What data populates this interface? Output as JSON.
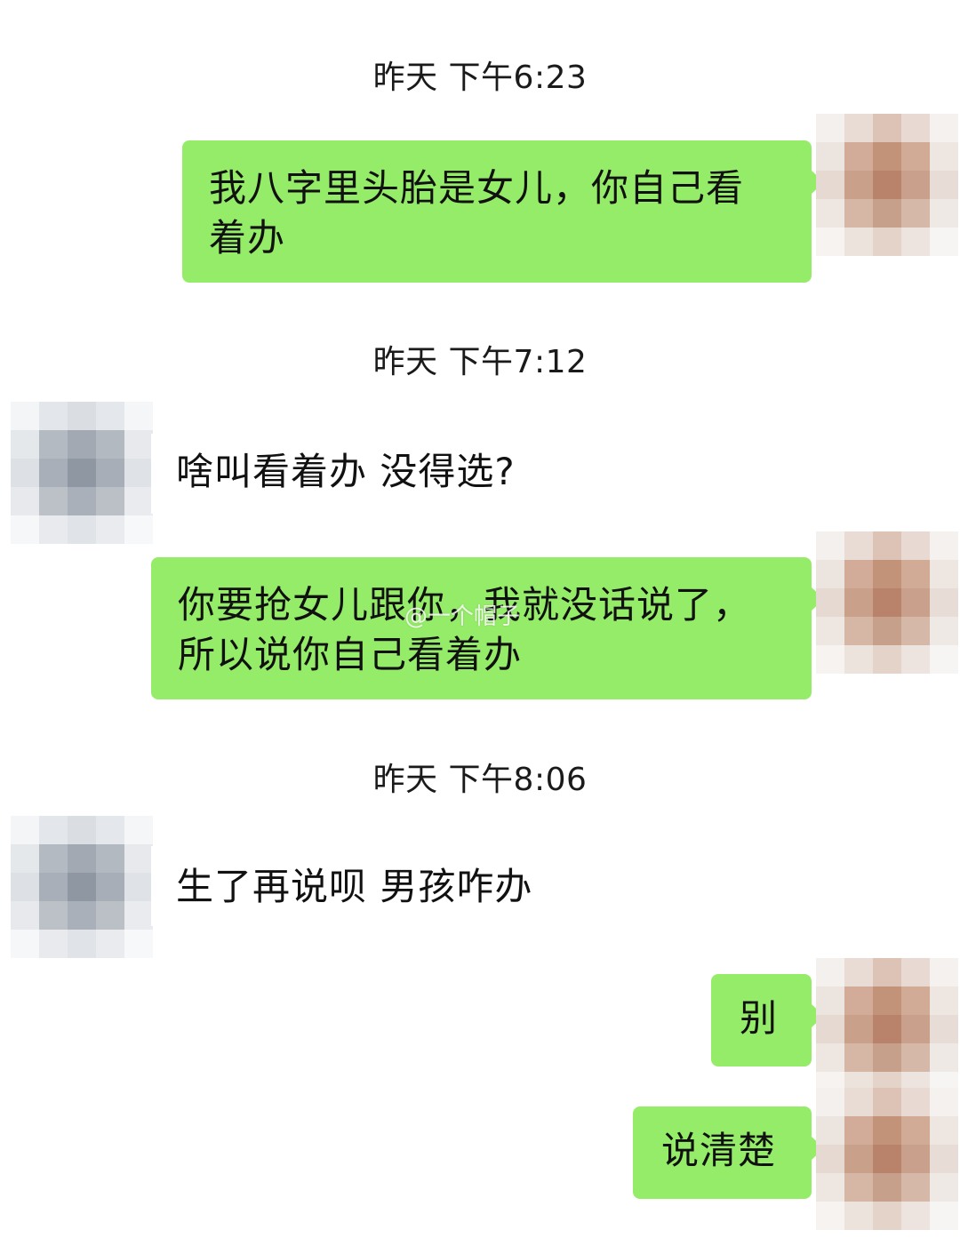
{
  "messages": [
    {
      "kind": "time",
      "text": "昨天 下午6:23"
    },
    {
      "kind": "self",
      "lines": [
        "我八字里头胎是女儿，你自己看",
        "着办"
      ]
    },
    {
      "kind": "time",
      "text": "昨天 下午7:12"
    },
    {
      "kind": "other",
      "text": "啥叫看着办  没得选?"
    },
    {
      "kind": "self",
      "lines": [
        "你要抢女儿跟你，我就没话说了，",
        "所以说你自己看着办"
      ]
    },
    {
      "kind": "time",
      "text": "昨天 下午8:06"
    },
    {
      "kind": "other",
      "text": "生了再说呗  男孩咋办"
    },
    {
      "kind": "self",
      "text": "别"
    },
    {
      "kind": "self",
      "text": "说清楚"
    }
  ],
  "watermark": "@一个帽子",
  "colors": {
    "self_bubble": "#95ec69",
    "background": "#ffffff"
  },
  "avatars": {
    "self": "pixelated-skin-tone-avatar",
    "other": "pixelated-gray-avatar"
  }
}
